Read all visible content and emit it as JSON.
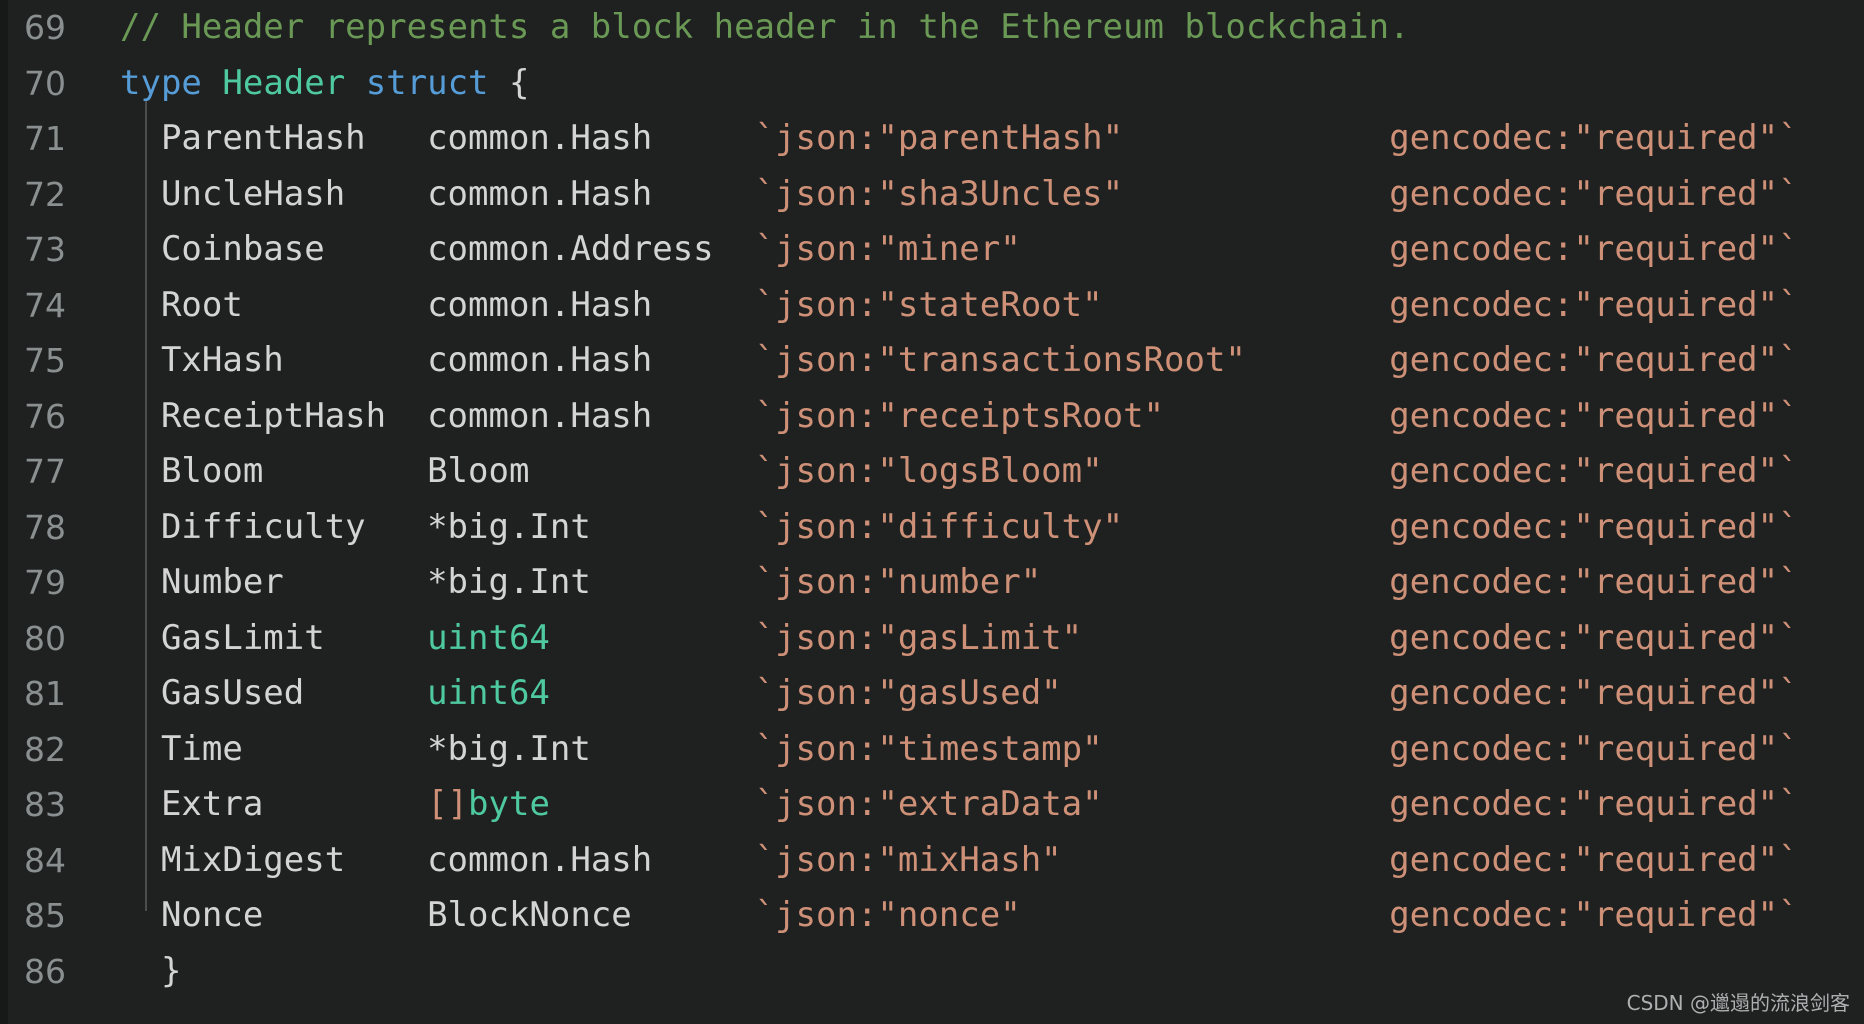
{
  "editor": {
    "language": "go",
    "theme": "dark",
    "background_color": "#1f2020",
    "gutter_color": "#8a8f8f",
    "indent_guide_color": "#4a4d4d",
    "colors": {
      "comment": "#6a9955",
      "keyword": "#569cd6",
      "type": "#4ec9a0",
      "plain": "#d4d4d4",
      "string": "#ce9178"
    },
    "first_line_number": 69,
    "last_line_number": 86,
    "lines": [
      {
        "number": "69",
        "kind": "comment",
        "comment": "// Header represents a block header in the Ethereum blockchain."
      },
      {
        "number": "70",
        "kind": "decl",
        "kw_type": "type",
        "name": "Header",
        "kw_struct": "struct",
        "brace": "{"
      },
      {
        "number": "71",
        "kind": "field",
        "field": "ParentHash",
        "type": "common.Hash",
        "type_style": "plain",
        "json_tag": "`json:\"parentHash\"",
        "gencodec_tag": "gencodec:\"required\"`"
      },
      {
        "number": "72",
        "kind": "field",
        "field": "UncleHash",
        "type": "common.Hash",
        "type_style": "plain",
        "json_tag": "`json:\"sha3Uncles\"",
        "gencodec_tag": "gencodec:\"required\"`"
      },
      {
        "number": "73",
        "kind": "field",
        "field": "Coinbase",
        "type": "common.Address",
        "type_style": "plain",
        "json_tag": "`json:\"miner\"",
        "gencodec_tag": "gencodec:\"required\"`"
      },
      {
        "number": "74",
        "kind": "field",
        "field": "Root",
        "type": "common.Hash",
        "type_style": "plain",
        "json_tag": "`json:\"stateRoot\"",
        "gencodec_tag": "gencodec:\"required\"`"
      },
      {
        "number": "75",
        "kind": "field",
        "field": "TxHash",
        "type": "common.Hash",
        "type_style": "plain",
        "json_tag": "`json:\"transactionsRoot\"",
        "gencodec_tag": "gencodec:\"required\"`"
      },
      {
        "number": "76",
        "kind": "field",
        "field": "ReceiptHash",
        "type": "common.Hash",
        "type_style": "plain",
        "json_tag": "`json:\"receiptsRoot\"",
        "gencodec_tag": "gencodec:\"required\"`"
      },
      {
        "number": "77",
        "kind": "field",
        "field": "Bloom",
        "type": "Bloom",
        "type_style": "plain",
        "json_tag": "`json:\"logsBloom\"",
        "gencodec_tag": "gencodec:\"required\"`"
      },
      {
        "number": "78",
        "kind": "field",
        "field": "Difficulty",
        "type": "*big.Int",
        "type_style": "plain",
        "json_tag": "`json:\"difficulty\"",
        "gencodec_tag": "gencodec:\"required\"`"
      },
      {
        "number": "79",
        "kind": "field",
        "field": "Number",
        "type": "*big.Int",
        "type_style": "plain",
        "json_tag": "`json:\"number\"",
        "gencodec_tag": "gencodec:\"required\"`"
      },
      {
        "number": "80",
        "kind": "field",
        "field": "GasLimit",
        "type": "uint64",
        "type_style": "builtin",
        "json_tag": "`json:\"gasLimit\"",
        "gencodec_tag": "gencodec:\"required\"`"
      },
      {
        "number": "81",
        "kind": "field",
        "field": "GasUsed",
        "type": "uint64",
        "type_style": "builtin",
        "json_tag": "`json:\"gasUsed\"",
        "gencodec_tag": "gencodec:\"required\"`"
      },
      {
        "number": "82",
        "kind": "field",
        "field": "Time",
        "type": "*big.Int",
        "type_style": "plain",
        "json_tag": "`json:\"timestamp\"",
        "gencodec_tag": "gencodec:\"required\"`"
      },
      {
        "number": "83",
        "kind": "field",
        "field": "Extra",
        "type_prefix": "[]",
        "type": "byte",
        "type_style": "builtin",
        "json_tag": "`json:\"extraData\"",
        "gencodec_tag": "gencodec:\"required\"`"
      },
      {
        "number": "84",
        "kind": "field",
        "field": "MixDigest",
        "type": "common.Hash",
        "type_style": "plain",
        "json_tag": "`json:\"mixHash\"",
        "gencodec_tag": "gencodec:\"required\"`"
      },
      {
        "number": "85",
        "kind": "field",
        "field": "Nonce",
        "type": "BlockNonce",
        "type_style": "plain",
        "json_tag": "`json:\"nonce\"",
        "gencodec_tag": "gencodec:\"required\"`"
      },
      {
        "number": "86",
        "kind": "close",
        "brace": "}"
      }
    ]
  },
  "watermark": {
    "text": "CSDN @邋遢的流浪剑客"
  }
}
